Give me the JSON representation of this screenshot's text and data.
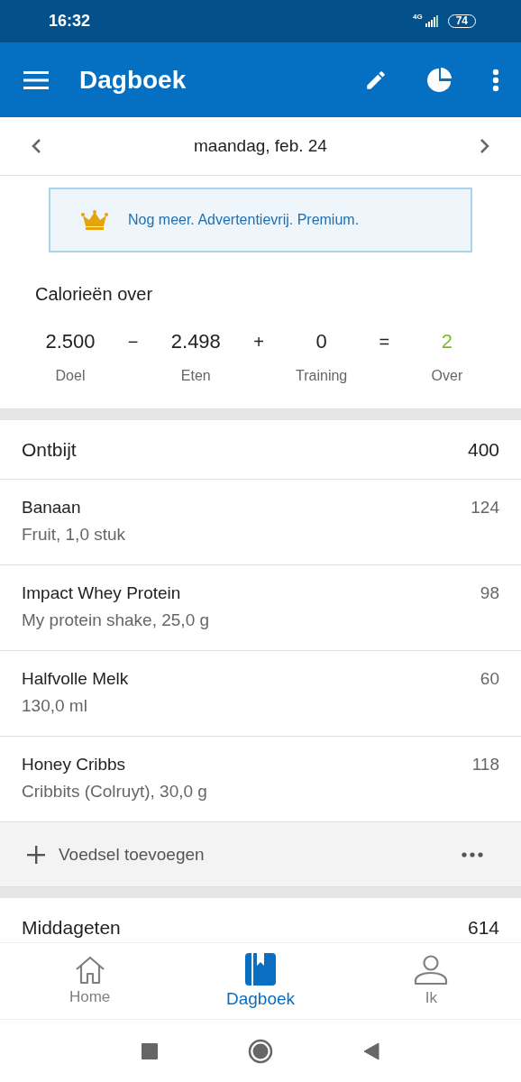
{
  "status_bar": {
    "time": "16:32",
    "network": "4G",
    "battery": "74"
  },
  "app_bar": {
    "title": "Dagboek"
  },
  "date_nav": {
    "date": "maandag, feb. 24"
  },
  "premium_banner": {
    "text": "Nog meer. Advertentievrij. Premium."
  },
  "calories": {
    "title": "Calorieën over",
    "equation": [
      {
        "kind": "term",
        "value": "2.500",
        "label": "Doel"
      },
      {
        "kind": "operator",
        "symbol": "−"
      },
      {
        "kind": "term",
        "value": "2.498",
        "label": "Eten"
      },
      {
        "kind": "operator",
        "symbol": "+"
      },
      {
        "kind": "term",
        "value": "0",
        "label": "Training"
      },
      {
        "kind": "operator",
        "symbol": "="
      },
      {
        "kind": "result",
        "value": "2",
        "label": "Over"
      }
    ]
  },
  "meals": [
    {
      "name": "Ontbijt",
      "total": "400",
      "foods": [
        {
          "name": "Banaan",
          "detail": "Fruit, 1,0 stuk",
          "calories": "124"
        },
        {
          "name": "Impact Whey Protein",
          "detail": "My protein shake, 25,0 g",
          "calories": "98"
        },
        {
          "name": "Halfvolle Melk",
          "detail": "130,0 ml",
          "calories": "60"
        },
        {
          "name": "Honey Cribbs",
          "detail": "Cribbits (Colruyt), 30,0 g",
          "calories": "118"
        }
      ],
      "add_label": "Voedsel toevoegen"
    },
    {
      "name": "Middageten",
      "total": "614"
    }
  ],
  "bottom_nav": [
    {
      "kind": "home",
      "label": "Home",
      "selected": false
    },
    {
      "kind": "diary",
      "label": "Dagboek",
      "selected": true
    },
    {
      "kind": "profile",
      "label": "Ik",
      "selected": false
    }
  ]
}
